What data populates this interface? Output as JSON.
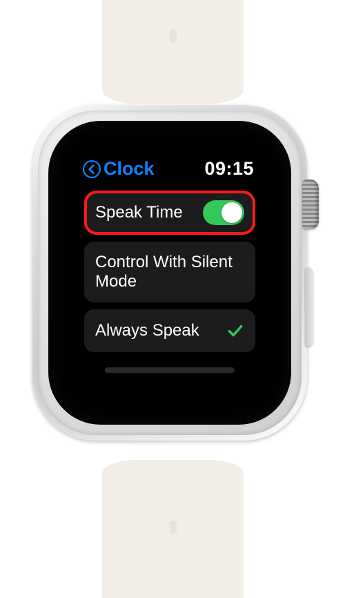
{
  "header": {
    "title": "Clock",
    "time": "09:15"
  },
  "rows": {
    "speakTime": {
      "label": "Speak Time",
      "toggle_on": true
    },
    "controlSilent": {
      "label": "Control With Silent Mode"
    },
    "alwaysSpeak": {
      "label": "Always Speak",
      "selected": true
    }
  },
  "colors": {
    "accent": "#0a84ff",
    "toggle_on": "#34c759",
    "highlight": "#ff1a1a",
    "check": "#34c759"
  }
}
